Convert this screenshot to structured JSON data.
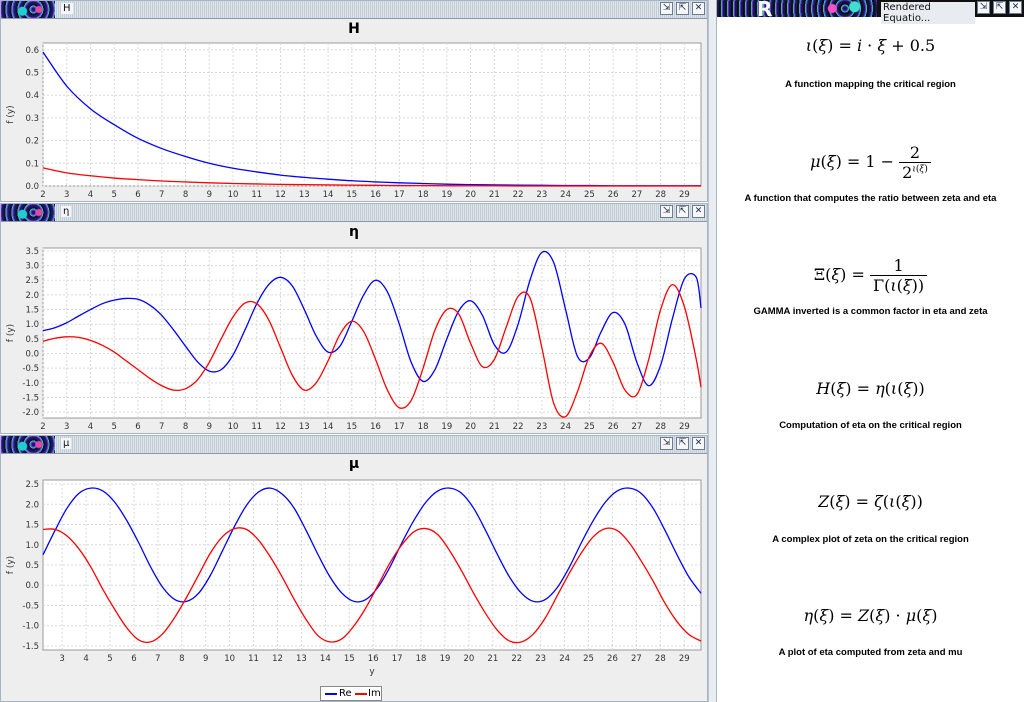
{
  "windows": [
    {
      "id": "H",
      "title": "H",
      "chart_title": "H",
      "ylabel": "f (y)",
      "xlabel": "",
      "x_ticks": [
        "2",
        "3",
        "4",
        "5",
        "6",
        "7",
        "8",
        "9",
        "10",
        "11",
        "12",
        "13",
        "14",
        "15",
        "16",
        "17",
        "18",
        "19",
        "20",
        "21",
        "22",
        "23",
        "24",
        "25",
        "26",
        "27",
        "28",
        "29"
      ],
      "y_ticks": [
        "0.6",
        "0.5",
        "0.4",
        "0.3",
        "0.2",
        "0.1",
        "0.0"
      ]
    },
    {
      "id": "eta",
      "title": "η",
      "chart_title": "η",
      "ylabel": "f (y)",
      "xlabel": "",
      "x_ticks": [
        "2",
        "3",
        "4",
        "5",
        "6",
        "7",
        "8",
        "9",
        "10",
        "11",
        "12",
        "13",
        "14",
        "15",
        "16",
        "17",
        "18",
        "19",
        "20",
        "21",
        "22",
        "23",
        "24",
        "25",
        "26",
        "27",
        "28",
        "29"
      ],
      "y_ticks": [
        "3.5",
        "3.0",
        "2.5",
        "2.0",
        "1.5",
        "1.0",
        "0.5",
        "0.0",
        "-0.5",
        "-1.0",
        "-1.5",
        "-2.0"
      ]
    },
    {
      "id": "mu",
      "title": "μ",
      "chart_title": "μ",
      "ylabel": "f (y)",
      "xlabel": "y",
      "x_ticks": [
        "3",
        "4",
        "5",
        "6",
        "7",
        "8",
        "9",
        "10",
        "11",
        "12",
        "13",
        "14",
        "15",
        "16",
        "17",
        "18",
        "19",
        "20",
        "21",
        "22",
        "23",
        "24",
        "25",
        "26",
        "27",
        "28",
        "29"
      ],
      "y_ticks": [
        "2.5",
        "2.0",
        "1.5",
        "1.0",
        "0.5",
        "0.0",
        "-0.5",
        "-1.0",
        "-1.5"
      ]
    }
  ],
  "legend": {
    "re": "Re",
    "im": "Im"
  },
  "equations_panel": {
    "title": "Rendered Equatio...",
    "logo_letter": "R",
    "items": [
      {
        "desc": "A function mapping the critical region"
      },
      {
        "desc": "A function that computes the ratio between zeta and eta"
      },
      {
        "desc": "GAMMA inverted is a common factor in eta and zeta"
      },
      {
        "desc": "Computation of eta on the critical region"
      },
      {
        "desc": "A complex plot of zeta on the critical region"
      },
      {
        "desc": "A plot of eta computed from zeta and mu"
      }
    ]
  },
  "colors": {
    "re": "#0000ff",
    "im": "#ff0000",
    "grid": "#d8d8d8"
  },
  "chart_data": [
    {
      "type": "line",
      "title": "H",
      "ylabel": "f (y)",
      "xlim": [
        2,
        29.7
      ],
      "ylim": [
        0,
        0.63
      ],
      "x": [
        2,
        3,
        4,
        5,
        6,
        7,
        8,
        9,
        10,
        11,
        12,
        13,
        14,
        15,
        16,
        17,
        18,
        19,
        20,
        21,
        22,
        23,
        24,
        25,
        26,
        27,
        28,
        29,
        29.7
      ],
      "series": [
        {
          "name": "Re",
          "values": [
            0.59,
            0.44,
            0.34,
            0.27,
            0.21,
            0.165,
            0.13,
            0.1,
            0.078,
            0.062,
            0.048,
            0.038,
            0.03,
            0.023,
            0.018,
            0.014,
            0.011,
            0.008,
            0.006,
            0.005,
            0.004,
            0.003,
            0.002,
            0.002,
            0.001,
            0.001,
            0.001,
            0.001,
            0.001
          ]
        },
        {
          "name": "Im",
          "values": [
            0.08,
            0.058,
            0.045,
            0.035,
            0.028,
            0.022,
            0.018,
            0.014,
            0.011,
            0.009,
            0.007,
            0.006,
            0.005,
            0.004,
            0.003,
            0.002,
            0.002,
            0.001,
            0.001,
            0.001,
            0,
            0,
            0,
            0,
            0,
            0,
            0,
            0,
            0
          ]
        }
      ]
    },
    {
      "type": "line",
      "title": "η",
      "ylabel": "f (y)",
      "xlim": [
        2,
        29.7
      ],
      "ylim": [
        -2.2,
        3.6
      ],
      "x": [
        2,
        2.5,
        3,
        3.5,
        4,
        4.5,
        5,
        5.5,
        6,
        6.5,
        7,
        7.5,
        8,
        8.5,
        9,
        9.5,
        10,
        10.5,
        11,
        11.5,
        12,
        12.5,
        13,
        13.5,
        14,
        14.5,
        15,
        15.5,
        16,
        16.5,
        17,
        17.5,
        18,
        18.5,
        19,
        19.5,
        20,
        20.5,
        21,
        21.5,
        22,
        22.5,
        23,
        23.5,
        24,
        24.5,
        25,
        25.5,
        26,
        26.5,
        27,
        27.5,
        28,
        28.5,
        29,
        29.5,
        29.7
      ],
      "series": [
        {
          "name": "Re",
          "values": [
            0.78,
            0.88,
            1.05,
            1.28,
            1.5,
            1.7,
            1.82,
            1.88,
            1.85,
            1.65,
            1.3,
            0.8,
            0.25,
            -0.28,
            -0.6,
            -0.55,
            -0.05,
            0.8,
            1.7,
            2.35,
            2.6,
            2.3,
            1.5,
            0.6,
            0.05,
            0.25,
            1.1,
            2.0,
            2.5,
            2.1,
            1.0,
            -0.3,
            -0.95,
            -0.55,
            0.5,
            1.45,
            1.8,
            1.3,
            0.3,
            0.05,
            1.0,
            2.5,
            3.45,
            3.1,
            1.5,
            -0.1,
            -0.15,
            0.75,
            1.4,
            1.0,
            -0.3,
            -1.1,
            -0.4,
            1.2,
            2.55,
            2.6,
            1.55
          ]
        },
        {
          "name": "Im",
          "values": [
            0.42,
            0.52,
            0.57,
            0.55,
            0.45,
            0.28,
            0.05,
            -0.25,
            -0.55,
            -0.85,
            -1.1,
            -1.25,
            -1.2,
            -0.9,
            -0.3,
            0.5,
            1.25,
            1.72,
            1.7,
            1.15,
            0.2,
            -0.75,
            -1.25,
            -1.0,
            -0.25,
            0.65,
            1.1,
            0.75,
            -0.2,
            -1.25,
            -1.85,
            -1.6,
            -0.5,
            0.8,
            1.5,
            1.35,
            0.35,
            -0.45,
            -0.2,
            0.9,
            1.95,
            1.9,
            0.2,
            -1.7,
            -2.15,
            -1.3,
            -0.1,
            0.35,
            -0.3,
            -1.25,
            -1.4,
            -0.2,
            1.5,
            2.35,
            1.6,
            -0.2,
            -1.15
          ]
        }
      ]
    },
    {
      "type": "line",
      "title": "μ",
      "xlabel": "y",
      "ylabel": "f (y)",
      "xlim": [
        2.2,
        29.7
      ],
      "ylim": [
        -1.6,
        2.6
      ],
      "x": [
        2.2,
        2.7,
        3.2,
        3.7,
        4.2,
        4.7,
        5.2,
        5.7,
        6.2,
        6.7,
        7.2,
        7.7,
        8.2,
        8.7,
        9.2,
        9.7,
        10.2,
        10.7,
        11.2,
        11.7,
        12.2,
        12.7,
        13.2,
        13.7,
        14.2,
        14.7,
        15.2,
        15.7,
        16.2,
        16.7,
        17.2,
        17.7,
        18.2,
        18.7,
        19.2,
        19.7,
        20.2,
        20.7,
        21.2,
        21.7,
        22.2,
        22.7,
        23.2,
        23.7,
        24.2,
        24.7,
        25.2,
        25.7,
        26.2,
        26.7,
        27.2,
        27.7,
        28.2,
        28.7,
        29.2,
        29.7
      ],
      "series": [
        {
          "name": "Re",
          "values": [
            0.75,
            1.35,
            1.9,
            2.27,
            2.4,
            2.33,
            2.05,
            1.6,
            1.05,
            0.45,
            -0.05,
            -0.35,
            -0.4,
            -0.2,
            0.25,
            0.85,
            1.45,
            1.97,
            2.3,
            2.4,
            2.25,
            1.9,
            1.35,
            0.75,
            0.2,
            -0.2,
            -0.4,
            -0.35,
            -0.05,
            0.45,
            1.05,
            1.6,
            2.05,
            2.33,
            2.4,
            2.27,
            1.9,
            1.35,
            0.75,
            0.2,
            -0.2,
            -0.4,
            -0.35,
            -0.05,
            0.45,
            1.05,
            1.6,
            2.05,
            2.33,
            2.4,
            2.27,
            1.9,
            1.35,
            0.75,
            0.2,
            -0.2
          ]
        },
        {
          "name": "Im",
          "values": [
            1.38,
            1.38,
            1.22,
            0.9,
            0.45,
            -0.1,
            -0.6,
            -1.05,
            -1.35,
            -1.4,
            -1.2,
            -0.8,
            -0.3,
            0.25,
            0.8,
            1.2,
            1.4,
            1.38,
            1.12,
            0.7,
            0.2,
            -0.35,
            -0.85,
            -1.25,
            -1.4,
            -1.32,
            -1.0,
            -0.55,
            0.0,
            0.55,
            1.0,
            1.32,
            1.4,
            1.25,
            0.85,
            0.35,
            -0.2,
            -0.7,
            -1.12,
            -1.38,
            -1.4,
            -1.2,
            -0.8,
            -0.25,
            0.3,
            0.8,
            1.2,
            1.4,
            1.35,
            1.05,
            0.6,
            0.1,
            -0.45,
            -0.9,
            -1.22,
            -1.38
          ]
        }
      ]
    }
  ]
}
